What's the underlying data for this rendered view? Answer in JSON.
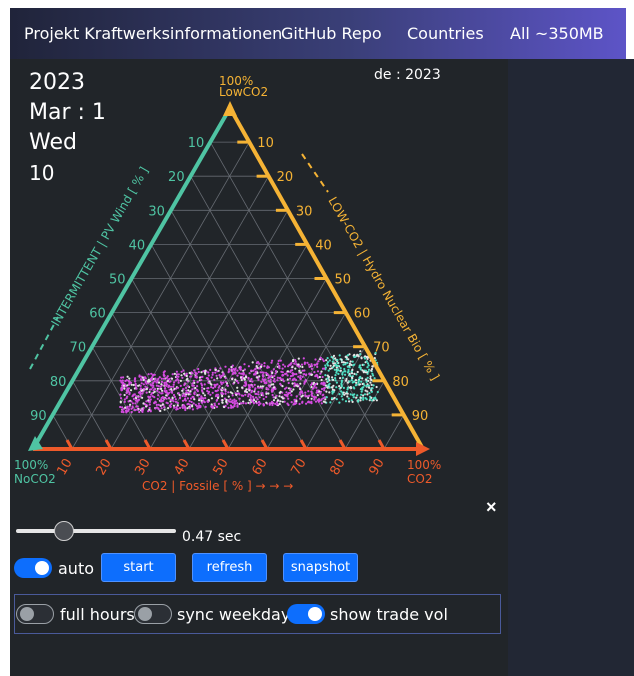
{
  "nav": {
    "brand": "Projekt Kraftwerksinformationen",
    "items": [
      "GitHub Repo",
      "Countries",
      "All ~350MB"
    ]
  },
  "date": {
    "year": "2023",
    "month_day": "Mar : 1",
    "weekday": "Wed",
    "hour": "10"
  },
  "country_label": "de : 2023",
  "ternary": {
    "colors": {
      "left": "#4fc4a3",
      "right": "#f5b335",
      "bottom": "#ee5a2a",
      "magenta": "#d44be0",
      "white": "#e6e6e6",
      "cyan": "#4fe0c4",
      "grid": "#666b72"
    },
    "top_vertex": [
      "100%",
      "LowCO2"
    ],
    "left_vertex": [
      "100%",
      "NoCO2"
    ],
    "right_vertex": [
      "100%",
      "CO2"
    ],
    "left_axis_title": "INTERMITTENT | PV  Wind [ % ]",
    "right_axis_title": "LOW-CO2 | Hydro Nuclear Bio [ % ]",
    "bottom_axis_title": "CO2 | Fossile [ % ] → → →",
    "ticks": [
      "10",
      "20",
      "30",
      "40",
      "50",
      "60",
      "70",
      "80",
      "90"
    ]
  },
  "controls": {
    "close_symbol": "×",
    "speed": "0.47 sec",
    "slider_fraction": 0.27,
    "auto_label": "auto",
    "auto_on": true,
    "buttons": {
      "start": "start",
      "refresh": "refresh",
      "snapshot": "snapshot"
    },
    "options": {
      "full_hours": {
        "label": "full hours",
        "on": false
      },
      "sync_weekday": {
        "label": "sync weekday",
        "on": false
      },
      "show_trade_vol": {
        "label": "show trade vol",
        "on": true
      }
    }
  }
}
